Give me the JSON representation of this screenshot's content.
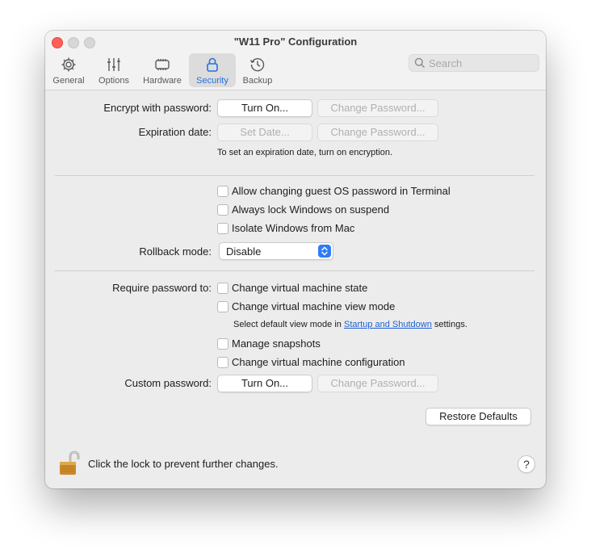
{
  "window": {
    "title": "\"W11 Pro\" Configuration"
  },
  "tabs": [
    {
      "label": "General",
      "icon": "gear-icon"
    },
    {
      "label": "Options",
      "icon": "sliders-icon"
    },
    {
      "label": "Hardware",
      "icon": "chip-icon"
    },
    {
      "label": "Security",
      "icon": "lock-icon",
      "active": true
    },
    {
      "label": "Backup",
      "icon": "clock-arrow-icon"
    }
  ],
  "search": {
    "placeholder": "Search",
    "value": ""
  },
  "encryption": {
    "encrypt_label": "Encrypt with password:",
    "turn_on": "Turn On...",
    "change_password": "Change Password...",
    "expiration_label": "Expiration date:",
    "set_date": "Set Date...",
    "hint": "To set an expiration date, turn on encryption."
  },
  "options": {
    "items": [
      {
        "label": "Allow changing guest OS password in Terminal",
        "checked": false
      },
      {
        "label": "Always lock Windows on suspend",
        "checked": false
      },
      {
        "label": "Isolate Windows from Mac",
        "checked": false
      }
    ],
    "rollback_label": "Rollback mode:",
    "rollback_value": "Disable"
  },
  "require": {
    "label": "Require password to:",
    "items": [
      {
        "label": "Change virtual machine state",
        "checked": false
      },
      {
        "label": "Change virtual machine view mode",
        "checked": false
      },
      {
        "label": "Manage snapshots",
        "checked": false
      },
      {
        "label": "Change virtual machine configuration",
        "checked": false
      }
    ],
    "hint_pre": "Select default view mode in",
    "hint_link": "Startup and Shutdown",
    "hint_post": "settings."
  },
  "custom": {
    "label": "Custom password:",
    "turn_on": "Turn On...",
    "change_password": "Change Password..."
  },
  "restore_defaults": "Restore Defaults",
  "footer": {
    "lock_text": "Click the lock to prevent further changes.",
    "help": "?"
  },
  "colors": {
    "accent": "#2470e0",
    "close": "#fe5f57",
    "link": "#1f5fd1"
  }
}
